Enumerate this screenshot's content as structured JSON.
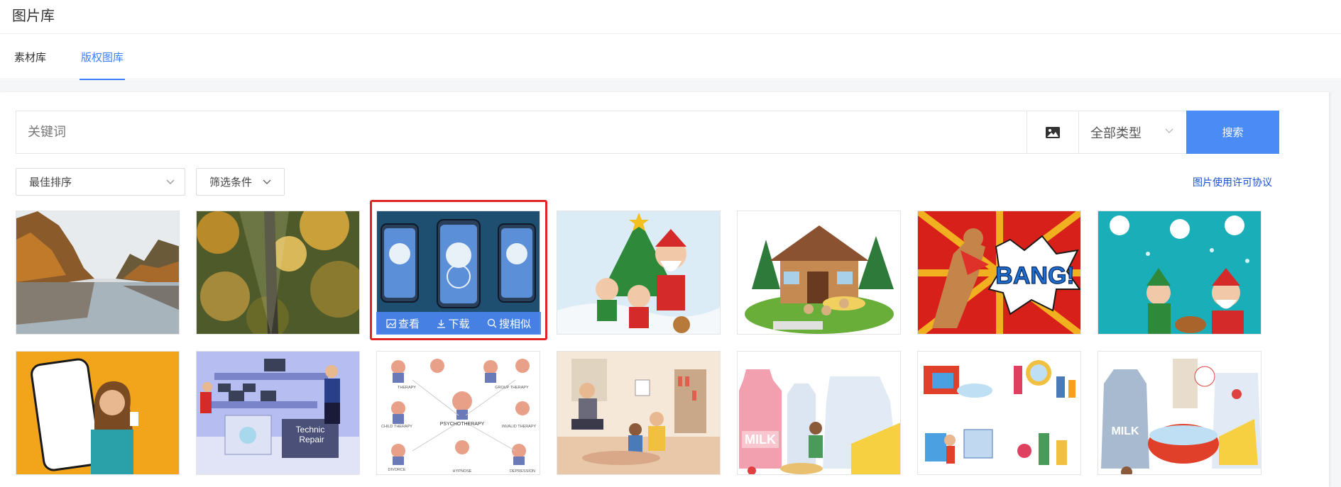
{
  "page": {
    "title": "图片库"
  },
  "tabs": [
    {
      "label": "素材库",
      "active": false
    },
    {
      "label": "版权图库",
      "active": true
    }
  ],
  "search": {
    "placeholder": "关键词",
    "type_selected": "全部类型",
    "button_label": "搜索",
    "image_search_icon": "image-icon"
  },
  "filters": {
    "sort_label": "最佳排序",
    "conditions_label": "筛选条件",
    "license_link": "图片使用许可协议"
  },
  "hover_actions": {
    "view": "查看",
    "download": "下载",
    "similar": "搜相似"
  },
  "images": [
    {
      "subject": "autumn-lake",
      "text": ""
    },
    {
      "subject": "autumn-forest-road",
      "text": ""
    },
    {
      "subject": "phone-mockups",
      "text": ""
    },
    {
      "subject": "christmas-santa-tree",
      "text": ""
    },
    {
      "subject": "log-cabin-pugs",
      "text": ""
    },
    {
      "subject": "bang-superhero-dog",
      "text": "BANG!"
    },
    {
      "subject": "christmas-elf-santa",
      "text": ""
    },
    {
      "subject": "woman-with-phone",
      "text": ""
    },
    {
      "subject": "technic-repair-shop",
      "text": "Technic Repair"
    },
    {
      "subject": "psychotherapy-infographic",
      "text": "PSYCHOTHERAPY",
      "labels": [
        "THERAPY",
        "GROUP THERAPY",
        "CHILD THERAPY",
        "INVALID THERAPY",
        "DIVORCE",
        "HYPNOSE",
        "DEPRESSION"
      ]
    },
    {
      "subject": "therapy-session",
      "text": ""
    },
    {
      "subject": "milk-cheese",
      "text": "MILK"
    },
    {
      "subject": "bathroom-cosmetics",
      "text": ""
    },
    {
      "subject": "milk-breakfast",
      "text": "MILK"
    }
  ]
}
